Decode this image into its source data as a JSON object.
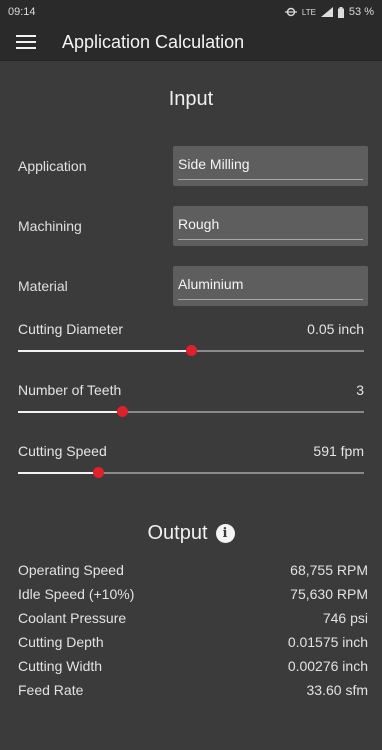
{
  "status": {
    "time": "09:14",
    "network": "LTE",
    "battery": "53 %"
  },
  "appbar": {
    "title": "Application Calculation"
  },
  "input": {
    "title": "Input",
    "fields": [
      {
        "label": "Application",
        "value": "Side Milling"
      },
      {
        "label": "Machining",
        "value": "Rough"
      },
      {
        "label": "Material",
        "value": "Aluminium"
      }
    ],
    "sliders": [
      {
        "label": "Cutting Diameter",
        "value": "0.05 inch",
        "level": 0.5
      },
      {
        "label": "Number of Teeth",
        "value": "3",
        "level": 0.3
      },
      {
        "label": "Cutting Speed",
        "value": "591 fpm",
        "level": 0.23
      }
    ]
  },
  "output": {
    "title": "Output",
    "rows": [
      {
        "label": "Operating Speed",
        "value": "68,755 RPM"
      },
      {
        "label": "Idle Speed (+10%)",
        "value": "75,630 RPM"
      },
      {
        "label": "Coolant Pressure",
        "value": "746 psi"
      },
      {
        "label": "Cutting Depth",
        "value": "0.01575 inch"
      },
      {
        "label": "Cutting Width",
        "value": "0.00276 inch"
      },
      {
        "label": "Feed Rate",
        "value": "33.60 sfm"
      }
    ]
  },
  "colors": {
    "background": "#3b3b3b",
    "appbar": "#2a2a2a",
    "field": "#5e5e5e",
    "accent": "#e0202a"
  },
  "icons": [
    "menu-icon",
    "info-icon",
    "data-icon",
    "signal-icon",
    "battery-icon"
  ]
}
